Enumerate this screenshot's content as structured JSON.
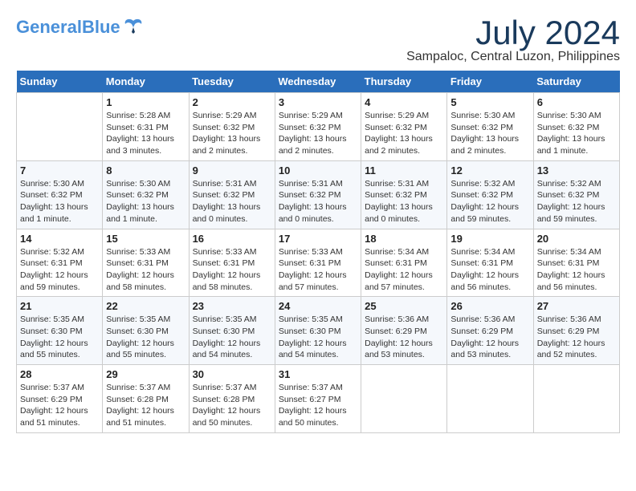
{
  "header": {
    "logo_general": "General",
    "logo_blue": "Blue",
    "month_title": "July 2024",
    "location": "Sampaloc, Central Luzon, Philippines"
  },
  "days_of_week": [
    "Sunday",
    "Monday",
    "Tuesday",
    "Wednesday",
    "Thursday",
    "Friday",
    "Saturday"
  ],
  "weeks": [
    [
      {
        "num": "",
        "empty": true
      },
      {
        "num": "1",
        "sunrise": "5:28 AM",
        "sunset": "6:31 PM",
        "daylight": "13 hours and 3 minutes."
      },
      {
        "num": "2",
        "sunrise": "5:29 AM",
        "sunset": "6:32 PM",
        "daylight": "13 hours and 2 minutes."
      },
      {
        "num": "3",
        "sunrise": "5:29 AM",
        "sunset": "6:32 PM",
        "daylight": "13 hours and 2 minutes."
      },
      {
        "num": "4",
        "sunrise": "5:29 AM",
        "sunset": "6:32 PM",
        "daylight": "13 hours and 2 minutes."
      },
      {
        "num": "5",
        "sunrise": "5:30 AM",
        "sunset": "6:32 PM",
        "daylight": "13 hours and 2 minutes."
      },
      {
        "num": "6",
        "sunrise": "5:30 AM",
        "sunset": "6:32 PM",
        "daylight": "13 hours and 1 minute."
      }
    ],
    [
      {
        "num": "7",
        "sunrise": "5:30 AM",
        "sunset": "6:32 PM",
        "daylight": "13 hours and 1 minute."
      },
      {
        "num": "8",
        "sunrise": "5:30 AM",
        "sunset": "6:32 PM",
        "daylight": "13 hours and 1 minute."
      },
      {
        "num": "9",
        "sunrise": "5:31 AM",
        "sunset": "6:32 PM",
        "daylight": "13 hours and 0 minutes."
      },
      {
        "num": "10",
        "sunrise": "5:31 AM",
        "sunset": "6:32 PM",
        "daylight": "13 hours and 0 minutes."
      },
      {
        "num": "11",
        "sunrise": "5:31 AM",
        "sunset": "6:32 PM",
        "daylight": "13 hours and 0 minutes."
      },
      {
        "num": "12",
        "sunrise": "5:32 AM",
        "sunset": "6:32 PM",
        "daylight": "12 hours and 59 minutes."
      },
      {
        "num": "13",
        "sunrise": "5:32 AM",
        "sunset": "6:32 PM",
        "daylight": "12 hours and 59 minutes."
      }
    ],
    [
      {
        "num": "14",
        "sunrise": "5:32 AM",
        "sunset": "6:31 PM",
        "daylight": "12 hours and 59 minutes."
      },
      {
        "num": "15",
        "sunrise": "5:33 AM",
        "sunset": "6:31 PM",
        "daylight": "12 hours and 58 minutes."
      },
      {
        "num": "16",
        "sunrise": "5:33 AM",
        "sunset": "6:31 PM",
        "daylight": "12 hours and 58 minutes."
      },
      {
        "num": "17",
        "sunrise": "5:33 AM",
        "sunset": "6:31 PM",
        "daylight": "12 hours and 57 minutes."
      },
      {
        "num": "18",
        "sunrise": "5:34 AM",
        "sunset": "6:31 PM",
        "daylight": "12 hours and 57 minutes."
      },
      {
        "num": "19",
        "sunrise": "5:34 AM",
        "sunset": "6:31 PM",
        "daylight": "12 hours and 56 minutes."
      },
      {
        "num": "20",
        "sunrise": "5:34 AM",
        "sunset": "6:31 PM",
        "daylight": "12 hours and 56 minutes."
      }
    ],
    [
      {
        "num": "21",
        "sunrise": "5:35 AM",
        "sunset": "6:30 PM",
        "daylight": "12 hours and 55 minutes."
      },
      {
        "num": "22",
        "sunrise": "5:35 AM",
        "sunset": "6:30 PM",
        "daylight": "12 hours and 55 minutes."
      },
      {
        "num": "23",
        "sunrise": "5:35 AM",
        "sunset": "6:30 PM",
        "daylight": "12 hours and 54 minutes."
      },
      {
        "num": "24",
        "sunrise": "5:35 AM",
        "sunset": "6:30 PM",
        "daylight": "12 hours and 54 minutes."
      },
      {
        "num": "25",
        "sunrise": "5:36 AM",
        "sunset": "6:29 PM",
        "daylight": "12 hours and 53 minutes."
      },
      {
        "num": "26",
        "sunrise": "5:36 AM",
        "sunset": "6:29 PM",
        "daylight": "12 hours and 53 minutes."
      },
      {
        "num": "27",
        "sunrise": "5:36 AM",
        "sunset": "6:29 PM",
        "daylight": "12 hours and 52 minutes."
      }
    ],
    [
      {
        "num": "28",
        "sunrise": "5:37 AM",
        "sunset": "6:29 PM",
        "daylight": "12 hours and 51 minutes."
      },
      {
        "num": "29",
        "sunrise": "5:37 AM",
        "sunset": "6:28 PM",
        "daylight": "12 hours and 51 minutes."
      },
      {
        "num": "30",
        "sunrise": "5:37 AM",
        "sunset": "6:28 PM",
        "daylight": "12 hours and 50 minutes."
      },
      {
        "num": "31",
        "sunrise": "5:37 AM",
        "sunset": "6:27 PM",
        "daylight": "12 hours and 50 minutes."
      },
      {
        "num": "",
        "empty": true
      },
      {
        "num": "",
        "empty": true
      },
      {
        "num": "",
        "empty": true
      }
    ]
  ]
}
